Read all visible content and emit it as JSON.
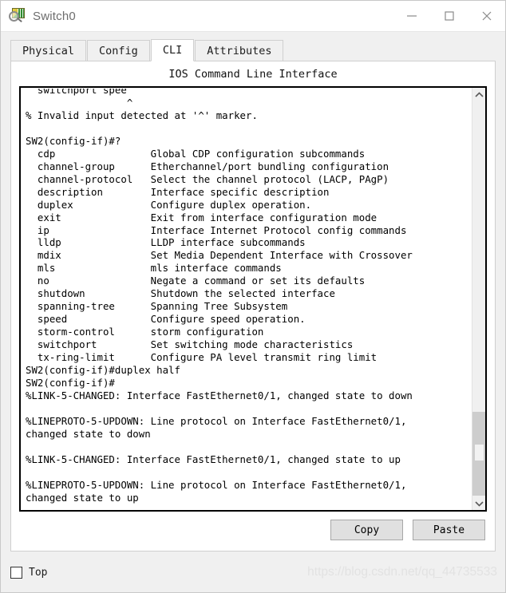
{
  "window": {
    "title": "Switch0",
    "icon": "packet-tracer-switch-icon",
    "controls": {
      "minimize": "–",
      "maximize": "□",
      "close": "×"
    }
  },
  "tabs": [
    {
      "label": "Physical",
      "active": false
    },
    {
      "label": "Config",
      "active": false
    },
    {
      "label": "CLI",
      "active": true
    },
    {
      "label": "Attributes",
      "active": false
    }
  ],
  "panel": {
    "title": "IOS Command Line Interface"
  },
  "terminal": {
    "clipped_top_line": "  switchport spee",
    "text": "                 ^\n% Invalid input detected at '^' marker.\n\nSW2(config-if)#?\n  cdp                Global CDP configuration subcommands\n  channel-group      Etherchannel/port bundling configuration\n  channel-protocol   Select the channel protocol (LACP, PAgP)\n  description        Interface specific description\n  duplex             Configure duplex operation.\n  exit               Exit from interface configuration mode\n  ip                 Interface Internet Protocol config commands\n  lldp               LLDP interface subcommands\n  mdix               Set Media Dependent Interface with Crossover\n  mls                mls interface commands\n  no                 Negate a command or set its defaults\n  shutdown           Shutdown the selected interface\n  spanning-tree      Spanning Tree Subsystem\n  speed              Configure speed operation.\n  storm-control      storm configuration\n  switchport         Set switching mode characteristics\n  tx-ring-limit      Configure PA level transmit ring limit\nSW2(config-if)#duplex half\nSW2(config-if)#\n%LINK-5-CHANGED: Interface FastEthernet0/1, changed state to down\n\n%LINEPROTO-5-UPDOWN: Line protocol on Interface FastEthernet0/1,\nchanged state to down\n\n%LINK-5-CHANGED: Interface FastEthernet0/1, changed state to up\n\n%LINEPROTO-5-UPDOWN: Line protocol on Interface FastEthernet0/1,\nchanged state to up\n",
    "prompt": "SW2(config-if)#",
    "last_command": "duplex half",
    "commands": [
      {
        "name": "cdp",
        "description": "Global CDP configuration subcommands"
      },
      {
        "name": "channel-group",
        "description": "Etherchannel/port bundling configuration"
      },
      {
        "name": "channel-protocol",
        "description": "Select the channel protocol (LACP, PAgP)"
      },
      {
        "name": "description",
        "description": "Interface specific description"
      },
      {
        "name": "duplex",
        "description": "Configure duplex operation."
      },
      {
        "name": "exit",
        "description": "Exit from interface configuration mode"
      },
      {
        "name": "ip",
        "description": "Interface Internet Protocol config commands"
      },
      {
        "name": "lldp",
        "description": "LLDP interface subcommands"
      },
      {
        "name": "mdix",
        "description": "Set Media Dependent Interface with Crossover"
      },
      {
        "name": "mls",
        "description": "mls interface commands"
      },
      {
        "name": "no",
        "description": "Negate a command or set its defaults"
      },
      {
        "name": "shutdown",
        "description": "Shutdown the selected interface"
      },
      {
        "name": "spanning-tree",
        "description": "Spanning Tree Subsystem"
      },
      {
        "name": "speed",
        "description": "Configure speed operation."
      },
      {
        "name": "storm-control",
        "description": "storm configuration"
      },
      {
        "name": "switchport",
        "description": "Set switching mode characteristics"
      },
      {
        "name": "tx-ring-limit",
        "description": "Configure PA level transmit ring limit"
      }
    ],
    "messages": [
      "%LINK-5-CHANGED: Interface FastEthernet0/1, changed state to down",
      "%LINEPROTO-5-UPDOWN: Line protocol on Interface FastEthernet0/1, changed state to down",
      "%LINK-5-CHANGED: Interface FastEthernet0/1, changed state to up",
      "%LINEPROTO-5-UPDOWN: Line protocol on Interface FastEthernet0/1, changed state to up"
    ],
    "error": "% Invalid input detected at '^' marker."
  },
  "scrollbar": {
    "up_arrow": "⌃",
    "down_arrow": "⌄"
  },
  "buttons": {
    "copy": "Copy",
    "paste": "Paste"
  },
  "footer": {
    "top_label": "Top",
    "top_checked": false,
    "watermark": "https://blog.csdn.net/qq_44735533"
  },
  "colors": {
    "window_bg": "#f0f0f0",
    "panel_bg": "#ffffff",
    "terminal_text": "#000000",
    "terminal_border": "#000000",
    "button_face": "#e0e0e0",
    "scrollbar_thumb": "#cdcdcd",
    "watermark": "#e2e2e2"
  }
}
